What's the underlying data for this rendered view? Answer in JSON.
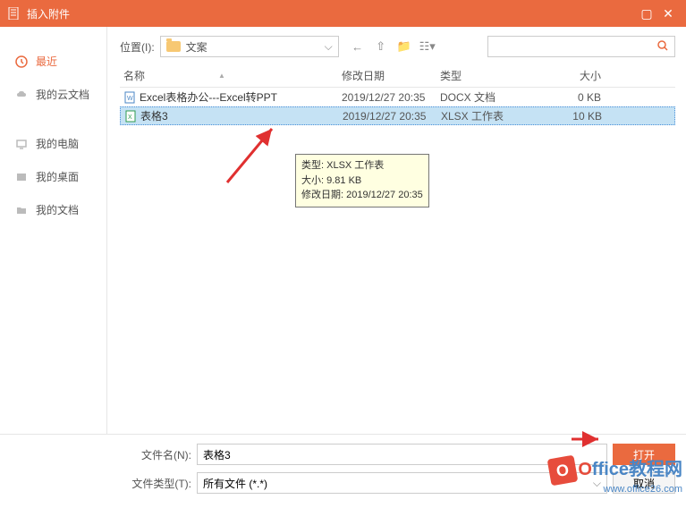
{
  "titlebar": {
    "title": "插入附件"
  },
  "sidebar": {
    "items": [
      {
        "label": "最近"
      },
      {
        "label": "我的云文档"
      },
      {
        "label": "我的电脑"
      },
      {
        "label": "我的桌面"
      },
      {
        "label": "我的文档"
      }
    ]
  },
  "location": {
    "label": "位置(I):",
    "folder": "文案"
  },
  "columns": {
    "name": "名称",
    "date": "修改日期",
    "type": "类型",
    "size": "大小"
  },
  "files": [
    {
      "name": "Excel表格办公---Excel转PPT",
      "date": "2019/12/27 20:35",
      "type": "DOCX 文档",
      "size": "0 KB"
    },
    {
      "name": "表格3",
      "date": "2019/12/27 20:35",
      "type": "XLSX 工作表",
      "size": "10 KB"
    }
  ],
  "tooltip": {
    "line1": "类型: XLSX 工作表",
    "line2": "大小: 9.81 KB",
    "line3": "修改日期: 2019/12/27 20:35"
  },
  "footer": {
    "filename_label": "文件名(N):",
    "filename_value": "表格3",
    "filetype_label": "文件类型(T):",
    "filetype_value": "所有文件 (*.*)",
    "open": "打开",
    "cancel": "取消"
  },
  "watermark": {
    "text": "ffice教程网",
    "url": "www.office26.com"
  }
}
